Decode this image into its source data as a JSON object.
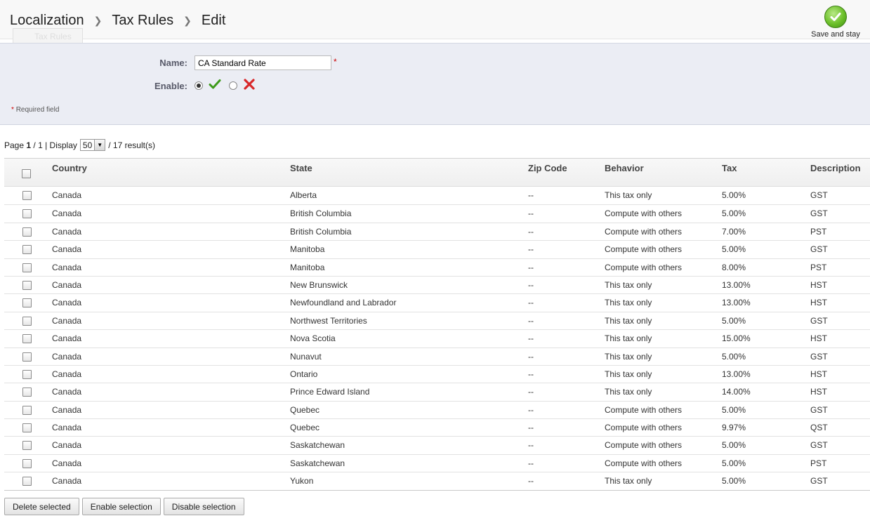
{
  "breadcrumb": [
    "Localization",
    "Tax Rules",
    "Edit"
  ],
  "toolbar": {
    "save_and_stay": "Save and stay",
    "save_icon": "check-circle-icon"
  },
  "ghost_tab": "Tax Rules",
  "form": {
    "name_label": "Name:",
    "name_value": "CA Standard Rate",
    "required_star": "*",
    "enable_label": "Enable:",
    "enable_selected": "yes",
    "required_note": "Required field"
  },
  "pagination": {
    "page_label": "Page",
    "page": "1",
    "pages": "/ 1",
    "display_label": "| Display",
    "per_page": "50",
    "results": "/ 17 result(s)"
  },
  "table": {
    "columns": [
      "Country",
      "State",
      "Zip Code",
      "Behavior",
      "Tax",
      "Description"
    ],
    "rows": [
      [
        "Canada",
        "Alberta",
        "--",
        "This tax only",
        "5.00%",
        "GST"
      ],
      [
        "Canada",
        "British Columbia",
        "--",
        "Compute with others",
        "5.00%",
        "GST"
      ],
      [
        "Canada",
        "British Columbia",
        "--",
        "Compute with others",
        "7.00%",
        "PST"
      ],
      [
        "Canada",
        "Manitoba",
        "--",
        "Compute with others",
        "5.00%",
        "GST"
      ],
      [
        "Canada",
        "Manitoba",
        "--",
        "Compute with others",
        "8.00%",
        "PST"
      ],
      [
        "Canada",
        "New Brunswick",
        "--",
        "This tax only",
        "13.00%",
        "HST"
      ],
      [
        "Canada",
        "Newfoundland and Labrador",
        "--",
        "This tax only",
        "13.00%",
        "HST"
      ],
      [
        "Canada",
        "Northwest Territories",
        "--",
        "This tax only",
        "5.00%",
        "GST"
      ],
      [
        "Canada",
        "Nova Scotia",
        "--",
        "This tax only",
        "15.00%",
        "HST"
      ],
      [
        "Canada",
        "Nunavut",
        "--",
        "This tax only",
        "5.00%",
        "GST"
      ],
      [
        "Canada",
        "Ontario",
        "--",
        "This tax only",
        "13.00%",
        "HST"
      ],
      [
        "Canada",
        "Prince Edward Island",
        "--",
        "This tax only",
        "14.00%",
        "HST"
      ],
      [
        "Canada",
        "Quebec",
        "--",
        "Compute with others",
        "5.00%",
        "GST"
      ],
      [
        "Canada",
        "Quebec",
        "--",
        "Compute with others",
        "9.97%",
        "QST"
      ],
      [
        "Canada",
        "Saskatchewan",
        "--",
        "Compute with others",
        "5.00%",
        "GST"
      ],
      [
        "Canada",
        "Saskatchewan",
        "--",
        "Compute with others",
        "5.00%",
        "PST"
      ],
      [
        "Canada",
        "Yukon",
        "--",
        "This tax only",
        "5.00%",
        "GST"
      ]
    ]
  },
  "bulk_actions": [
    "Delete selected",
    "Enable selection",
    "Disable selection"
  ],
  "colors": {
    "form_bg": "#ebedf4",
    "required": "#cc0000",
    "save_green": "#6cbf2a"
  }
}
